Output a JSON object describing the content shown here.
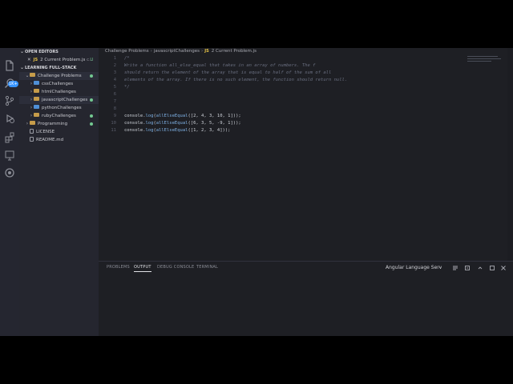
{
  "sidebar": {
    "open_editors_label": "OPEN EDITORS",
    "open_file": {
      "close": "✕",
      "icon": "JS",
      "name": "2 Current Problem.js",
      "path": "c...",
      "badge": "U"
    },
    "workspace_label": "LEARNING FULL-STACK",
    "tree": [
      {
        "label": "Challenge Problems",
        "expanded": true
      },
      {
        "label": "cssChallenges"
      },
      {
        "label": "htmlChallenges"
      },
      {
        "label": "javascriptChallenges"
      },
      {
        "label": "pythonChallenges"
      },
      {
        "label": "rubyChallenges"
      },
      {
        "label": "Programming"
      },
      {
        "label": "LICENSE"
      },
      {
        "label": "README.md"
      }
    ]
  },
  "activity_badge": "1K+",
  "breadcrumbs": {
    "part1": "Challenge Problems",
    "part2": "javascriptChallenges",
    "file_icon": "JS",
    "file": "2 Current Problem.js"
  },
  "code": {
    "line_numbers": [
      "1",
      "2",
      "3",
      "4",
      "5",
      "6",
      "7",
      "8",
      "9",
      "10",
      "11"
    ],
    "comment_lines": [
      "/*",
      "Write a function all_else_equal that takes in an array of numbers. The f",
      "should return the element of the array that is equal to half of the sum of all",
      "elements of the array. If there is no such element, the function should return null.",
      "*/"
    ],
    "calls": [
      {
        "obj": "console",
        "dot": ".",
        "method": "log",
        "open": "(",
        "fn": "allElseEqual",
        "args": "([2, 4, 3, 10, 1])",
        "close": ");"
      },
      {
        "obj": "console",
        "dot": ".",
        "method": "log",
        "open": "(",
        "fn": "allElseEqual",
        "args": "([6, 3, 5, -9, 1])",
        "close": ");"
      },
      {
        "obj": "console",
        "dot": ".",
        "method": "log",
        "open": "(",
        "fn": "allElseEqual",
        "args": "([1, 2, 3, 4])",
        "close": ");"
      }
    ]
  },
  "panel": {
    "tabs": [
      "PROBLEMS",
      "OUTPUT",
      "DEBUG CONSOLE",
      "TERMINAL"
    ],
    "active_tab": "OUTPUT",
    "output_channel": "Angular Language Serv",
    "dropdown_arrow": "⌄"
  }
}
